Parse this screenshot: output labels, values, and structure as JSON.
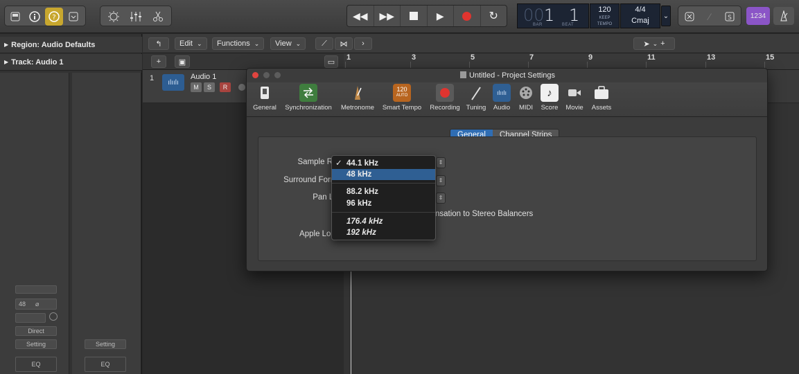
{
  "control_bar": {
    "lcd": {
      "bar": "1",
      "beat": "1",
      "bar_label": "BAR",
      "beat_label": "BEAT",
      "tempo": "120",
      "tempo_keep": "KEEP",
      "tempo_label": "TEMPO",
      "signature": "4/4",
      "key": "Cmaj",
      "counter": "1234"
    }
  },
  "inspector": {
    "region_label": "Region: Audio Defaults",
    "track_label": "Track: Audio 1",
    "strip": {
      "sample_rate_value": "48",
      "direct_label": "Direct",
      "setting_label": "Setting",
      "setting_label_2": "Setting",
      "eq_label": "EQ",
      "eq_label_2": "EQ"
    }
  },
  "tracks": {
    "toolbar": {
      "edit": "Edit",
      "functions": "Functions",
      "view": "View"
    },
    "track": {
      "number": "1",
      "name": "Audio 1",
      "mute": "M",
      "solo": "S",
      "record": "R"
    },
    "ruler": [
      "1",
      "3",
      "5",
      "7",
      "9",
      "11",
      "13",
      "15"
    ]
  },
  "window": {
    "title": "Untitled - Project Settings",
    "toolbar_items": [
      {
        "label": "General",
        "icon": "switch-icon"
      },
      {
        "label": "Synchronization",
        "icon": "sync-arrows-icon"
      },
      {
        "label": "Metronome",
        "icon": "metronome-icon"
      },
      {
        "label": "Smart Tempo",
        "icon": "smart-tempo-icon",
        "badge_top": "120",
        "badge_bottom": "AUTO"
      },
      {
        "label": "Recording",
        "icon": "record-icon"
      },
      {
        "label": "Tuning",
        "icon": "tuning-fork-icon"
      },
      {
        "label": "Audio",
        "icon": "audio-waveform-icon"
      },
      {
        "label": "MIDI",
        "icon": "midi-port-icon"
      },
      {
        "label": "Score",
        "icon": "score-note-icon"
      },
      {
        "label": "Movie",
        "icon": "movie-camera-icon"
      },
      {
        "label": "Assets",
        "icon": "briefcase-icon"
      }
    ],
    "tabs": {
      "general": "General",
      "channel_strips": "Channel Strips"
    },
    "labels": {
      "sample_rate": "Sample Rate",
      "surround_format": "Surround Format",
      "pan_law": "Pan Law",
      "apple_loops": "Apple Loops",
      "compensation_text": "nsation to Stereo Balancers"
    }
  },
  "sample_rate_menu": {
    "selected": "44.1 kHz",
    "items": [
      "44.1 kHz",
      "48 kHz",
      "88.2 kHz",
      "96 kHz",
      "176.4 kHz",
      "192 kHz"
    ],
    "check": "✓"
  },
  "colors": {
    "accent_blue": "#2f6db3",
    "record_red": "#e0342f",
    "count_in_purple": "#8b55c7",
    "active_yellow": "#c8a72e"
  }
}
